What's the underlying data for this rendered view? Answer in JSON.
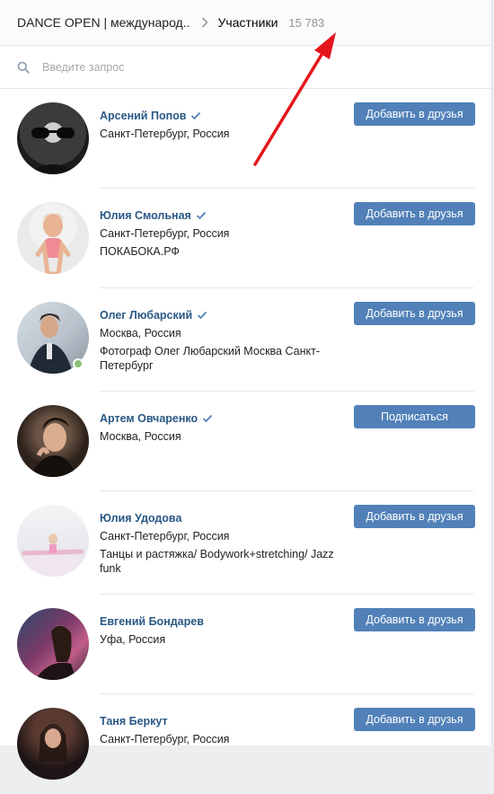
{
  "header": {
    "group_name": "DANCE OPEN | международ..",
    "section": "Участники",
    "count": "15 783"
  },
  "search": {
    "placeholder": "Введите запрос"
  },
  "members": [
    {
      "name": "Арсений Попов",
      "city": "Санкт-Петербург, Россия",
      "extra": "",
      "button": "Добавить в друзья",
      "verified": true,
      "online": false
    },
    {
      "name": "Юлия Смольная",
      "city": "Санкт-Петербург, Россия",
      "extra": "ПОКАБОКА.РФ",
      "button": "Добавить в друзья",
      "verified": true,
      "online": false
    },
    {
      "name": "Олег Любарский",
      "city": "Москва, Россия",
      "extra": "Фотограф Олег Любарский Москва Санкт-Петербург",
      "button": "Добавить в друзья",
      "verified": true,
      "online": true
    },
    {
      "name": "Артем Овчаренко",
      "city": "Москва, Россия",
      "extra": "",
      "button": "Подписаться",
      "verified": true,
      "online": false
    },
    {
      "name": "Юлия Удодова",
      "city": "Санкт-Петербург, Россия",
      "extra": "Танцы и растяжка/ Bodywork+stretching/ Jazz funk",
      "button": "Добавить в друзья",
      "verified": false,
      "online": false
    },
    {
      "name": "Евгений Бондарев",
      "city": "Уфа, Россия",
      "extra": "",
      "button": "Добавить в друзья",
      "verified": false,
      "online": false
    },
    {
      "name": "Таня Беркут",
      "city": "Санкт-Петербург, Россия",
      "extra": "",
      "button": "Добавить в друзья",
      "verified": false,
      "online": false
    }
  ],
  "colors": {
    "accent": "#5181b8",
    "link": "#2a5885",
    "annotation_arrow": "#e3161b",
    "online": "#8ac176"
  }
}
